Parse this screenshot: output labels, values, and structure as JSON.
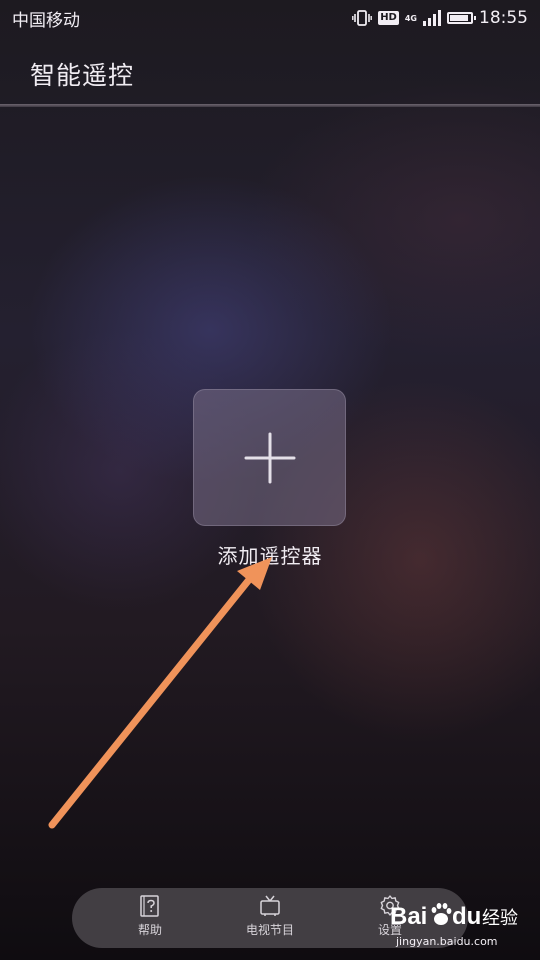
{
  "status_bar": {
    "carrier": "中国移动",
    "hd": "HD",
    "network": "4G",
    "time": "18:55"
  },
  "header": {
    "title": "智能遥控"
  },
  "main": {
    "add_remote_label": "添加遥控器"
  },
  "bottom_nav": {
    "items": [
      {
        "label": "帮助",
        "icon": "help-icon"
      },
      {
        "label": "电视节目",
        "icon": "tv-icon"
      },
      {
        "label": "设置",
        "icon": "gear-icon"
      }
    ]
  },
  "watermark": {
    "brand_bai": "Bai",
    "brand_du": "du",
    "brand_suffix": "经验",
    "url": "jingyan.baidu.com"
  },
  "colors": {
    "arrow": "#f0935a",
    "nav_background": "#464248",
    "button_background": "#786e87"
  }
}
